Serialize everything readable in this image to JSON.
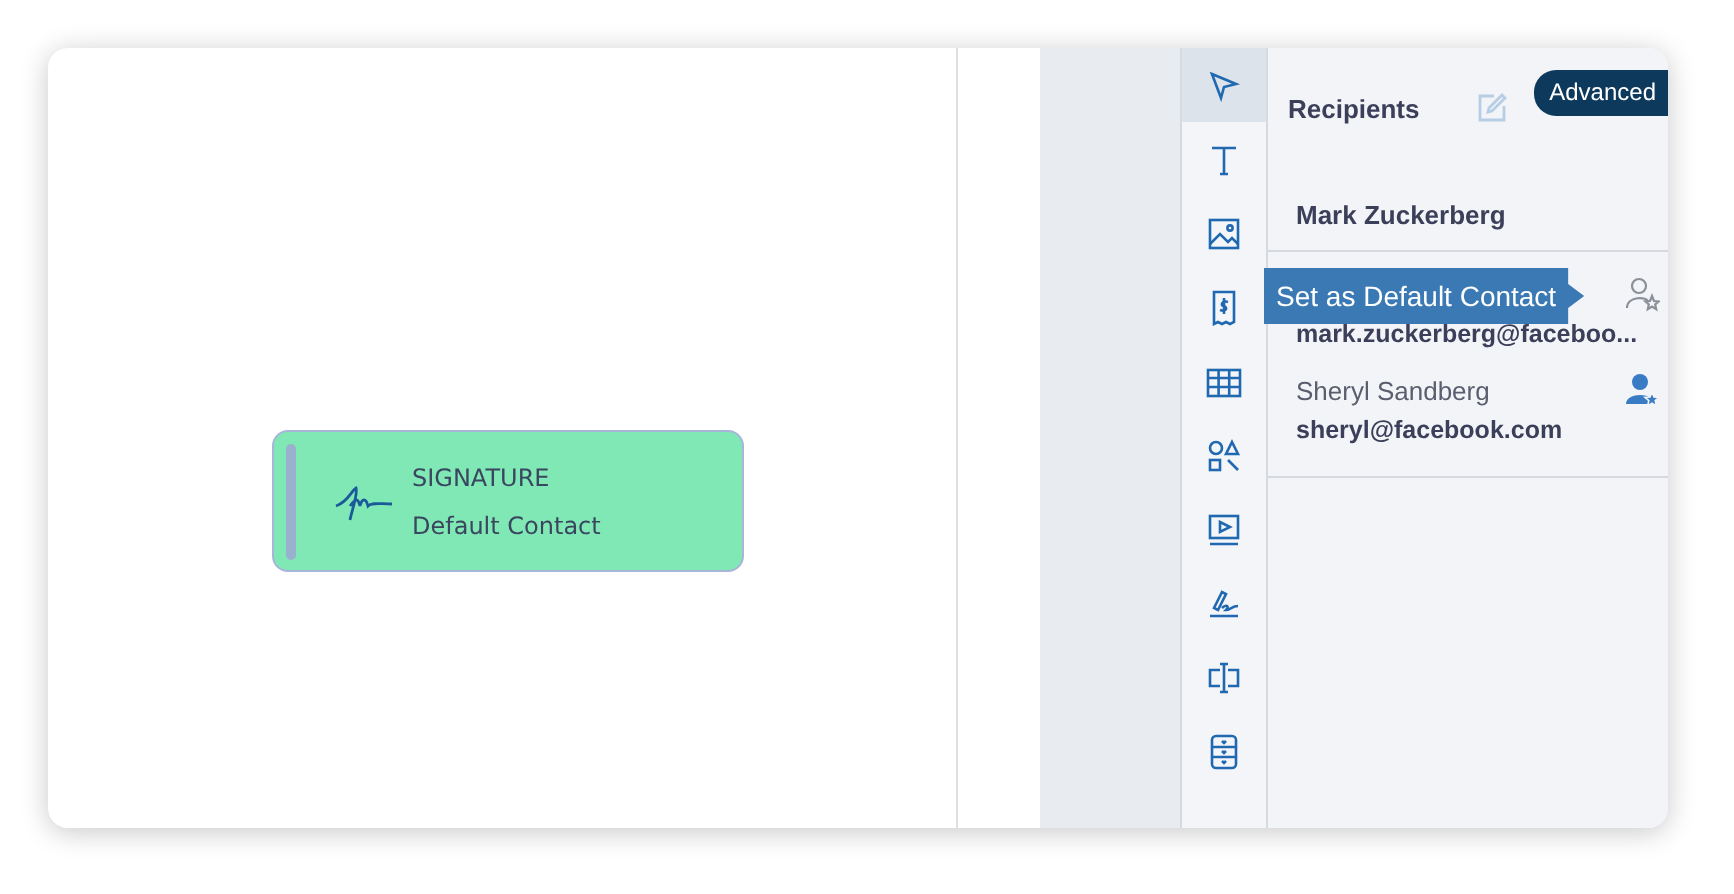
{
  "canvas": {
    "field": {
      "label": "SIGNATURE",
      "assignee": "Default Contact"
    }
  },
  "tools": [
    {
      "kind": "cursor",
      "selected": true
    },
    {
      "kind": "text",
      "selected": false
    },
    {
      "kind": "image",
      "selected": false
    },
    {
      "kind": "receipt",
      "selected": false
    },
    {
      "kind": "table",
      "selected": false
    },
    {
      "kind": "shapes",
      "selected": false
    },
    {
      "kind": "video",
      "selected": false
    },
    {
      "kind": "sign",
      "selected": false
    },
    {
      "kind": "textbox",
      "selected": false
    },
    {
      "kind": "cabinet",
      "selected": false
    }
  ],
  "panel": {
    "title": "Recipients",
    "advanced": "Advanced",
    "signer": "Mark Zuckerberg",
    "tooltip": "Set as Default Contact",
    "contacts": [
      {
        "email": "mark.zuckerberg@faceboo...",
        "default": false
      },
      {
        "name": "Sheryl Sandberg",
        "email": "sheryl@facebook.com",
        "default": true
      }
    ]
  }
}
